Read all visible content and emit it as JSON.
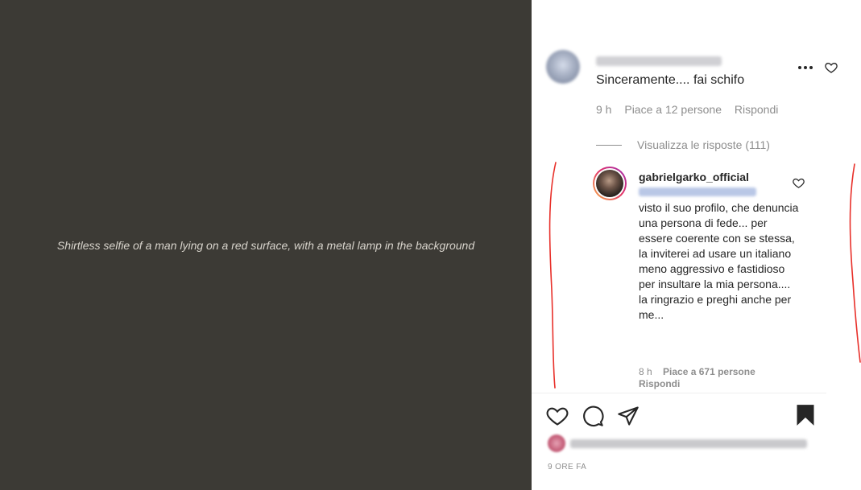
{
  "post": {
    "photo_alt": "Shirtless selfie of a man lying on a red surface, with a metal lamp in the background"
  },
  "top_comment": {
    "text": "Sinceramente.... fai schifo",
    "time": "9 h",
    "likes": "Piace a 12 persone",
    "reply_label": "Rispondi"
  },
  "replies": {
    "toggle_label": "Visualizza le risposte (111)"
  },
  "reply": {
    "username": "gabrielgarko_official",
    "text": "visto il suo profilo, che denuncia una persona di fede... per essere coerente con se stessa, la inviterei ad usare un italiano meno aggressivo e fastidioso per insultare la mia persona.... la ringrazio e preghi anche per me...",
    "time": "8 h",
    "likes": "Piace a 671 persone",
    "reply_label": "Rispondi"
  },
  "footer": {
    "post_time": "9 ORE FA"
  },
  "icons": {
    "more": "more-options-icon",
    "heart": "heart-icon",
    "comment": "comment-icon",
    "share": "share-icon",
    "bookmark": "bookmark-icon"
  },
  "colors": {
    "annotation": "#e8302a",
    "muted_text": "#8e8e8e"
  }
}
